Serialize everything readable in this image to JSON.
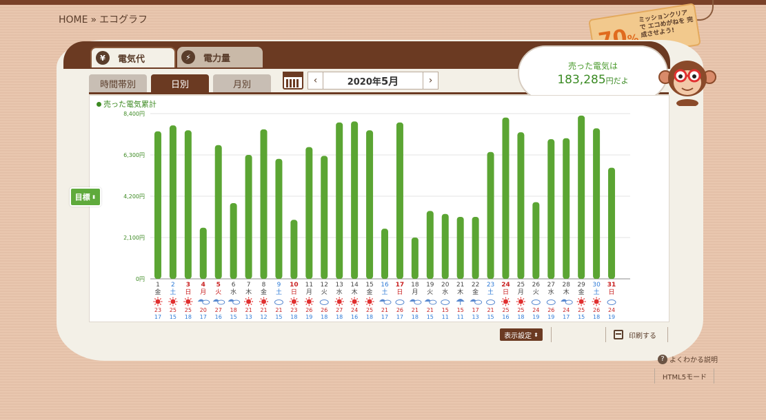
{
  "breadcrumb": {
    "home": "HOME",
    "sep": "»",
    "current": "エコグラフ"
  },
  "tabs": {
    "main": [
      {
        "label": "電気代",
        "icon": "¥",
        "icon_name": "yen-icon",
        "active": true
      },
      {
        "label": "電力量",
        "icon": "⚡",
        "icon_name": "bolt-icon",
        "active": false
      }
    ],
    "sub": [
      {
        "label": "時間帯別",
        "active": false
      },
      {
        "label": "日別",
        "active": true
      },
      {
        "label": "月別",
        "active": false
      }
    ]
  },
  "month_nav": {
    "prev": "‹",
    "next": "›",
    "year_label": "2020年",
    "month_label": "5月"
  },
  "bubble": {
    "line1": "売った電気は",
    "amount": "183,285",
    "suffix": "円だよ"
  },
  "mission_tag": {
    "percent": "70",
    "percent_sign": "%",
    "message": "ミッションクリアで エコめがねを 完成させよう!"
  },
  "target_button": {
    "label": "目標",
    "arrow": "⬍"
  },
  "chart_data": {
    "type": "bar",
    "title": "売った電気累計",
    "yticks": [
      "0円",
      "2,100円",
      "4,200円",
      "6,300円",
      "8,400円"
    ],
    "ylim": [
      0,
      8400
    ],
    "bar_color": "#5ba533",
    "days": [
      "1",
      "2",
      "3",
      "4",
      "5",
      "6",
      "7",
      "8",
      "9",
      "10",
      "11",
      "12",
      "13",
      "14",
      "15",
      "16",
      "17",
      "18",
      "19",
      "20",
      "21",
      "22",
      "23",
      "24",
      "25",
      "26",
      "27",
      "28",
      "29",
      "30",
      "31"
    ],
    "weekdays": [
      "金",
      "土",
      "日",
      "月",
      "火",
      "水",
      "木",
      "金",
      "土",
      "日",
      "月",
      "火",
      "水",
      "木",
      "金",
      "土",
      "日",
      "月",
      "火",
      "水",
      "木",
      "金",
      "土",
      "日",
      "月",
      "火",
      "水",
      "木",
      "金",
      "土",
      "日"
    ],
    "day_colors": [
      "#444",
      "#2e7ad6",
      "#c82020",
      "#c82020",
      "#c82020",
      "#444",
      "#444",
      "#444",
      "#2e7ad6",
      "#c82020",
      "#444",
      "#444",
      "#444",
      "#444",
      "#444",
      "#2e7ad6",
      "#c82020",
      "#444",
      "#444",
      "#444",
      "#444",
      "#444",
      "#2e7ad6",
      "#c82020",
      "#444",
      "#444",
      "#444",
      "#444",
      "#444",
      "#2e7ad6",
      "#c82020"
    ],
    "values": [
      7500,
      7800,
      7550,
      2600,
      6800,
      3850,
      6300,
      7600,
      6100,
      3000,
      6700,
      6250,
      7950,
      8000,
      7550,
      2550,
      7950,
      2100,
      3450,
      3300,
      3150,
      3150,
      6450,
      8200,
      7450,
      3900,
      7100,
      7150,
      8300,
      7650,
      5650
    ],
    "weather": [
      "sun",
      "sun",
      "sun",
      "umbrella-cloud",
      "umbrella-cloud",
      "umbrella-cloud",
      "sun",
      "sun",
      "cloud",
      "sun",
      "sun",
      "cloud",
      "sun",
      "sun",
      "sun",
      "umbrella-cloud",
      "cloud",
      "umbrella-cloud",
      "umbrella-cloud",
      "cloud",
      "umbrella",
      "umbrella-cloud",
      "cloud",
      "sun",
      "sun",
      "cloud",
      "cloud",
      "umbrella-cloud",
      "sun",
      "sun",
      "cloud"
    ],
    "temp_high": [
      "23",
      "25",
      "25",
      "20",
      "27",
      "18",
      "21",
      "21",
      "21",
      "23",
      "26",
      "26",
      "27",
      "24",
      "25",
      "21",
      "26",
      "21",
      "21",
      "15",
      "15",
      "17",
      "21",
      "25",
      "25",
      "24",
      "26",
      "24",
      "25",
      "26",
      "24"
    ],
    "temp_low": [
      "17",
      "15",
      "18",
      "17",
      "16",
      "15",
      "13",
      "12",
      "15",
      "18",
      "19",
      "18",
      "18",
      "16",
      "18",
      "17",
      "17",
      "18",
      "15",
      "11",
      "11",
      "13",
      "15",
      "16",
      "18",
      "19",
      "19",
      "17",
      "15",
      "18",
      "19"
    ]
  },
  "controls": {
    "display_settings": "表示設定",
    "print": "印刷する",
    "help": "よくわかる説明",
    "html5": "HTML5モード"
  }
}
